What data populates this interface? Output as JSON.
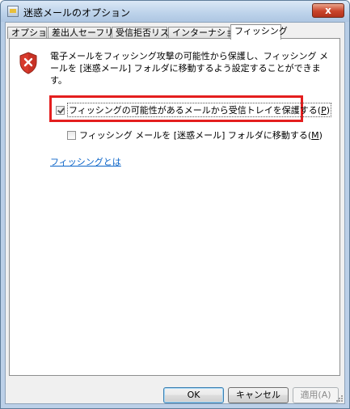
{
  "window": {
    "title": "迷惑メールのオプション",
    "close_glyph": "x"
  },
  "tabs": [
    {
      "label": "オプション",
      "active": false
    },
    {
      "label": "差出人セーフリスト",
      "active": false
    },
    {
      "label": "受信拒否リスト",
      "active": false
    },
    {
      "label": "インターナショナル",
      "active": false
    },
    {
      "label": "フィッシング",
      "active": true
    }
  ],
  "phishing": {
    "description": "電子メールをフィッシング攻撃の可能性から保護し、フィッシング メールを [迷惑メール] フォルダに移動するよう設定することができます。",
    "protect_checkbox": {
      "label": "フィッシングの可能性があるメールから受信トレイを保護する(",
      "accel": "P",
      "suffix": ")",
      "checked": true
    },
    "move_checkbox": {
      "label": "フィッシング メールを [迷惑メール] フォルダに移動する(",
      "accel": "M",
      "suffix": ")",
      "checked": false,
      "enabled": false
    },
    "link": "フィッシングとは"
  },
  "buttons": {
    "ok": "OK",
    "cancel": "キャンセル",
    "apply": "適用(A)"
  },
  "colors": {
    "highlight": "#e41e1e",
    "link": "#0b64c8"
  }
}
